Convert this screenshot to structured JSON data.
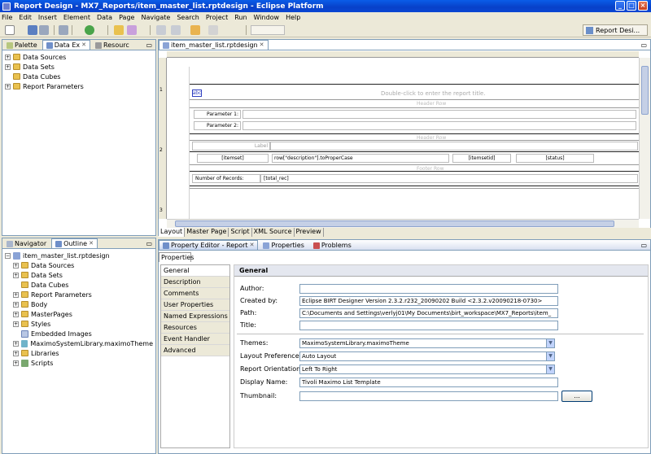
{
  "window": {
    "title": "Report Design - MX7_Reports/item_master_list.rptdesign - Eclipse Platform"
  },
  "menu": [
    "File",
    "Edit",
    "Insert",
    "Element",
    "Data",
    "Page",
    "Navigate",
    "Search",
    "Project",
    "Run",
    "Window",
    "Help"
  ],
  "toolbar": {
    "perspective_label": "Report Desi..."
  },
  "top_left_panel": {
    "tabs": [
      {
        "label": "Palette"
      },
      {
        "label": "Data Ex"
      },
      {
        "label": "Resourc"
      }
    ],
    "tree": [
      "Data Sources",
      "Data Sets",
      "Data Cubes",
      "Report Parameters"
    ]
  },
  "editor": {
    "tab_label": "item_master_list.rptdesign",
    "report": {
      "title_placeholder": "Double-click to enter the report title.",
      "label_marker": "abc",
      "header_row_ghost": "Header Row",
      "param1_label": "Parameter 1:",
      "param2_label": "Parameter 2:",
      "label_cell": "Label",
      "header_ghost2": "Header Row",
      "detail_cells": [
        "[itemset]",
        "row[\"description\"].toProperCase",
        "[itemsetid]",
        "[status]"
      ],
      "footer_ghost": "Footer Row",
      "records_label": "Number of Records:",
      "records_value": "[total_rec]"
    },
    "bottom_tabs": [
      "Layout",
      "Master Page",
      "Script",
      "XML Source",
      "Preview"
    ],
    "ruler_marks": [
      "1",
      "2",
      "3"
    ]
  },
  "outline_panel": {
    "tabs": [
      {
        "label": "Navigator"
      },
      {
        "label": "Outline"
      }
    ],
    "root": "item_master_list.rptdesign",
    "items": [
      "Data Sources",
      "Data Sets",
      "Data Cubes",
      "Report Parameters",
      "Body",
      "MasterPages",
      "Styles",
      "Embedded Images",
      "MaximoSystemLibrary.maximoTheme",
      "Libraries",
      "Scripts"
    ]
  },
  "property_editor": {
    "tabs": [
      {
        "label": "Property Editor - Report"
      },
      {
        "label": "Properties"
      },
      {
        "label": "Problems"
      }
    ],
    "subtab": "Properties",
    "nav": [
      "General",
      "Description",
      "Comments",
      "User Properties",
      "Named Expressions",
      "Resources",
      "Event Handler",
      "Advanced"
    ],
    "section_title": "General",
    "fields": {
      "author_label": "Author:",
      "author_value": "",
      "created_by_label": "Created by:",
      "created_by_value": "Eclipse BIRT Designer Version 2.3.2.r232_20090202 Build <2.3.2.v20090218-0730>",
      "path_label": "Path:",
      "path_value": "C:\\Documents and Settings\\verlyj01\\My Documents\\birt_workspace\\MX7_Reports\\item_",
      "title_label": "Title:",
      "title_value": "",
      "themes_label": "Themes:",
      "themes_value": "MaximoSystemLibrary.maximoTheme",
      "layout_pref_label": "Layout Preference:",
      "layout_pref_value": "Auto Layout",
      "orientation_label": "Report Orientation:",
      "orientation_value": "Left To Right",
      "display_name_label": "Display Name:",
      "display_name_value": "Tivoli Maximo List Template",
      "thumbnail_label": "Thumbnail:",
      "thumbnail_value": "",
      "browse_label": "..."
    }
  }
}
